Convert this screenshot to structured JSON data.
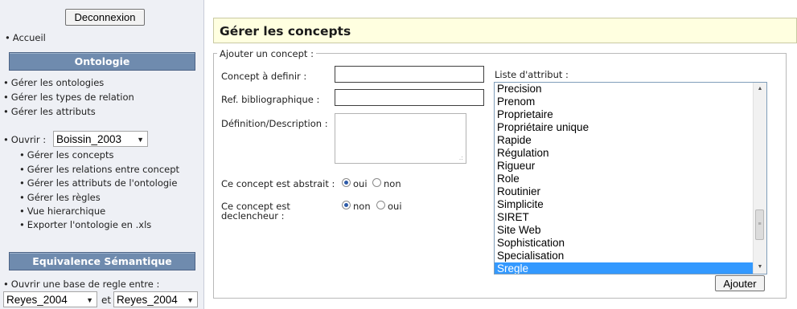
{
  "sidebar": {
    "logout_label": "Deconnexion",
    "home_link": "Accueil",
    "ontology_section": {
      "title": "Ontologie",
      "links": [
        "Gérer les ontologies",
        "Gérer les types de relation",
        "Gérer les attributs"
      ]
    },
    "open": {
      "label": "Ouvrir :",
      "selected": "Boissin_2003",
      "sublinks": [
        "Gérer les concepts",
        "Gérer les relations entre concept",
        "Gérer les attributs de l'ontologie",
        "Gérer les règles",
        "Vue hierarchique",
        "Exporter l'ontologie en .xls"
      ]
    },
    "equivalence_section": {
      "title": "Equivalence Sémantique",
      "open_rules_label": "Ouvrir une base de regle entre :",
      "select_a": "Reyes_2004",
      "and_label": "et",
      "select_b": "Reyes_2004"
    }
  },
  "main": {
    "page_title": "Gérer les concepts",
    "legend": "Ajouter un concept :",
    "form": {
      "concept_label": "Concept à definir :",
      "concept_value": "",
      "ref_label": "Ref. bibliographique :",
      "ref_value": "",
      "description_label": "Définition/Description :",
      "abstract_label": "Ce concept est abstrait :",
      "abstract_options": [
        "oui",
        "non"
      ],
      "abstract_selected": "oui",
      "trigger_label_line1": "Ce concept est",
      "trigger_label_line2": "declencheur :",
      "trigger_options": [
        "non",
        "oui"
      ],
      "trigger_selected": "non"
    },
    "attributes": {
      "label": "Liste d'attribut :",
      "items": [
        "Precision",
        "Prenom",
        "Proprietaire",
        "Propriétaire unique",
        "Rapide",
        "Régulation",
        "Rigueur",
        "Role",
        "Routinier",
        "Simplicite",
        "SIRET",
        "Site Web",
        "Sophistication",
        "Specialisation",
        "Sregle"
      ],
      "selected": "Sregle"
    },
    "add_button": "Ajouter"
  },
  "colors": {
    "section_header_bg": "#6f8bae",
    "title_bar_bg": "#ffffe0",
    "selection_bg": "#3399ff",
    "sidebar_bg": "#eef0f5"
  }
}
